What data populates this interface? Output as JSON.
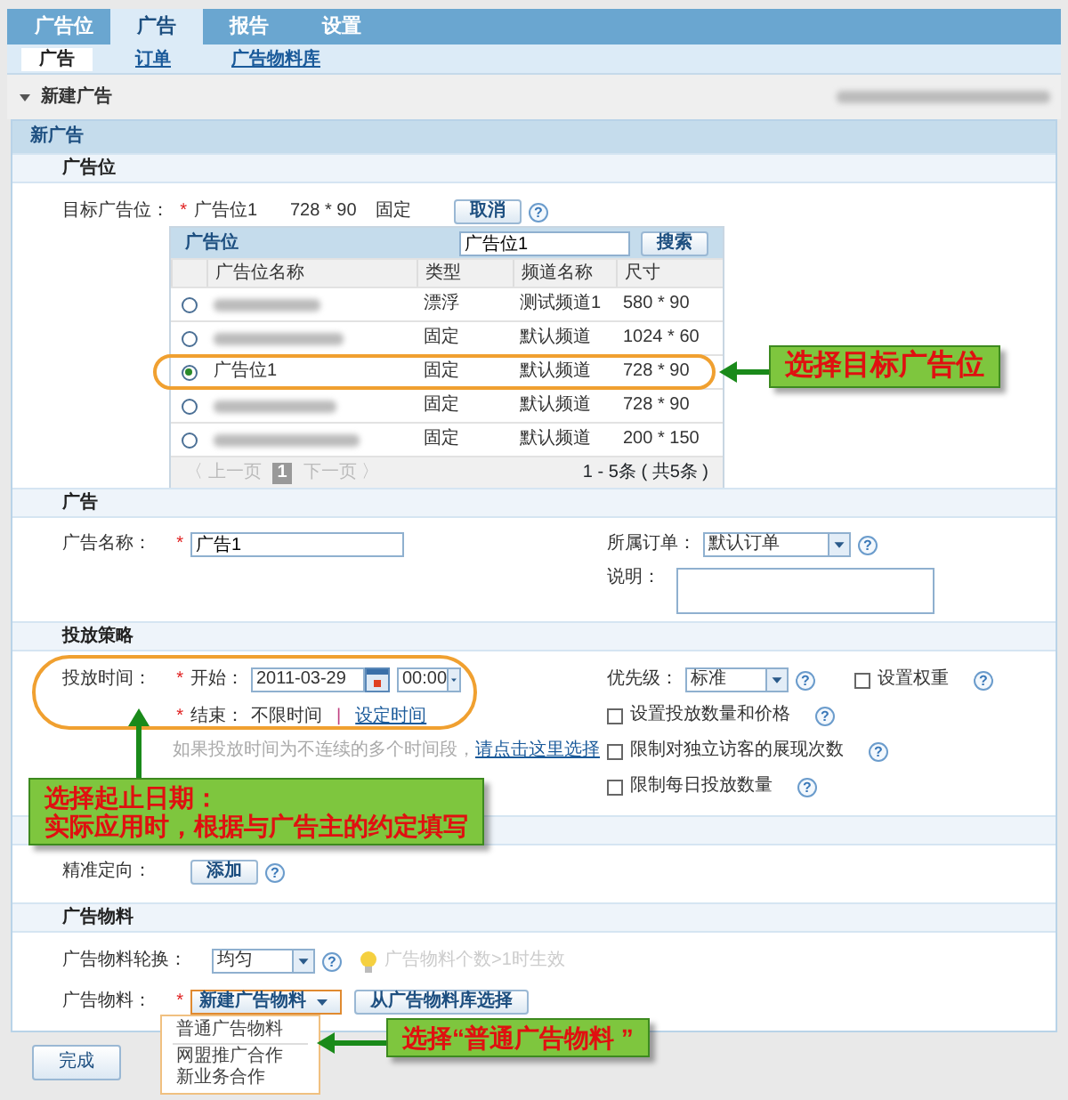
{
  "main_tabs": [
    {
      "label": "广告位",
      "selected": false
    },
    {
      "label": "广告",
      "selected": true
    },
    {
      "label": "报告",
      "selected": false
    },
    {
      "label": "设置",
      "selected": false
    }
  ],
  "sub_tabs": [
    {
      "label": "广告",
      "selected": true
    },
    {
      "label": "订单",
      "selected": false
    },
    {
      "label": "广告物料库",
      "selected": false
    }
  ],
  "page_header": {
    "expanded": true,
    "title": "新建广告",
    "account_redacted": true
  },
  "panel_title": "新广告",
  "slot_section": {
    "title": "广告位",
    "label": "目标广告位：",
    "mark": "*",
    "value": "广告位1",
    "size": "728 * 90",
    "type": "固定",
    "cancel_button": "取消",
    "help": "?",
    "picker": {
      "title": "广告位",
      "search_value": "广告位1",
      "search_button": "搜索",
      "columns": [
        "广告位名称",
        "类型",
        "频道名称",
        "尺寸"
      ],
      "rows": [
        {
          "selected": false,
          "name_redacted": true,
          "type": "漂浮",
          "channel": "测试频道1",
          "size": "580 * 90"
        },
        {
          "selected": false,
          "name_redacted": true,
          "type": "固定",
          "channel": "默认频道",
          "size": "1024 * 60"
        },
        {
          "selected": true,
          "name_redacted": false,
          "name": "广告位1",
          "type": "固定",
          "channel": "默认频道",
          "size": "728 * 90"
        },
        {
          "selected": false,
          "name_redacted": true,
          "type": "固定",
          "channel": "默认频道",
          "size": "728 * 90"
        },
        {
          "selected": false,
          "name_redacted": true,
          "type": "固定",
          "channel": "默认频道",
          "size": "200 * 150"
        }
      ],
      "pager": {
        "prev": "〈 上一页",
        "page": "1",
        "next": "下一页 〉",
        "summary": "1 - 5条 ( 共5条 )"
      }
    }
  },
  "ad_section": {
    "title": "广告",
    "name_label": "广告名称：",
    "name_mark": "*",
    "name_value": "广告1",
    "order_label": "所属订单：",
    "order_value": "默认订单",
    "order_help": "?",
    "note_label": "说明："
  },
  "strategy_section": {
    "title": "投放策略",
    "time_label": "投放时间：",
    "start_mark": "*",
    "start_label": "开始：",
    "start_date": "2011-03-29",
    "start_time": "00:00",
    "end_mark": "*",
    "end_label": "结束：",
    "end_value": "不限时间",
    "separator": "|",
    "end_link": "设定时间",
    "hint": "如果投放时间为不连续的多个时间段，",
    "hint_link": "请点击这里选择",
    "priority_label": "优先级：",
    "priority_value": "标准",
    "priority_help": "?",
    "options": [
      {
        "label": "设置权重",
        "checked": false,
        "help": "?"
      },
      {
        "label": "设置投放数量和价格",
        "checked": false,
        "help": "?"
      },
      {
        "label": "限制对独立访客的展现次数",
        "checked": false,
        "help": "?"
      },
      {
        "label": "限制每日投放数量",
        "checked": false,
        "help": "?"
      }
    ]
  },
  "targeting_section": {
    "label": "精准定向：",
    "add_button": "添加",
    "help": "?"
  },
  "creative_section": {
    "title": "广告物料",
    "rotation_label": "广告物料轮换：",
    "rotation_value": "均匀",
    "help": "?",
    "tip": "广告物料个数>1时生效",
    "creative_label": "广告物料：",
    "mark": "*",
    "new_button": "新建广告物料",
    "library_button": "从广告物料库选择",
    "menu": [
      {
        "kind": "item",
        "label": "普通广告物料"
      },
      {
        "kind": "divider"
      },
      {
        "kind": "item",
        "label": "网盟推广合作"
      },
      {
        "kind": "item",
        "label": "新业务合作"
      }
    ]
  },
  "finish_button": "完成",
  "annotations": [
    {
      "lines": [
        "选择目标广告位"
      ]
    },
    {
      "lines": [
        "选择起止日期：",
        "实际应用时，根据与广告主的约定填写"
      ]
    },
    {
      "lines": [
        "选择“普通广告物料 ”"
      ]
    }
  ]
}
